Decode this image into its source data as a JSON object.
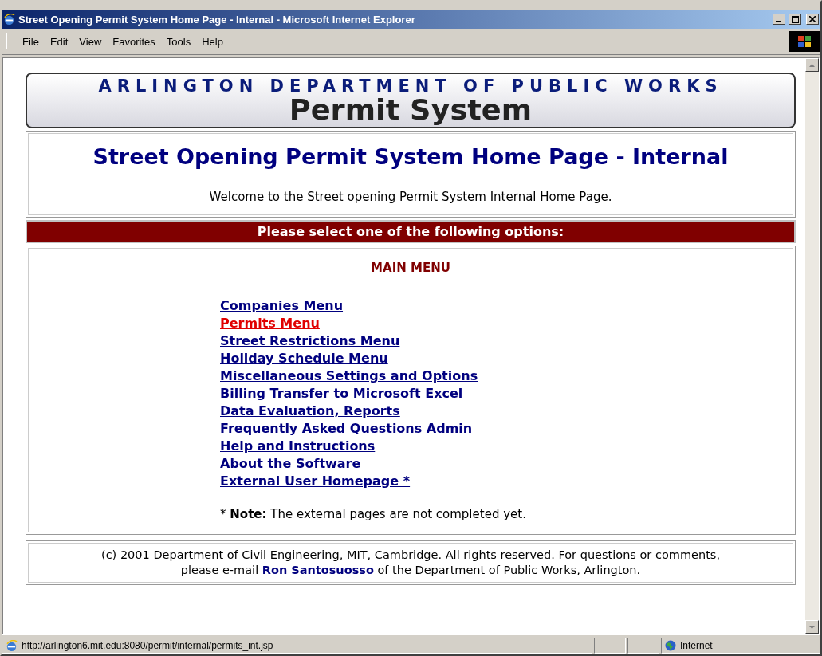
{
  "window": {
    "title": "Street Opening Permit System Home Page - Internal - Microsoft Internet Explorer"
  },
  "menu_bar": [
    "File",
    "Edit",
    "View",
    "Favorites",
    "Tools",
    "Help"
  ],
  "banner": {
    "organization": "ARLINGTON DEPARTMENT OF PUBLIC WORKS",
    "product": "Permit System"
  },
  "header": {
    "title": "Street Opening Permit System Home Page - Internal",
    "welcome": "Welcome to the Street opening Permit System Internal Home Page."
  },
  "options_bar": "Please select one of the following options:",
  "main_menu": {
    "heading": "MAIN MENU",
    "links": [
      {
        "label": "Companies Menu",
        "selected": false
      },
      {
        "label": "Permits Menu",
        "selected": true
      },
      {
        "label": "Street Restrictions Menu",
        "selected": false
      },
      {
        "label": "Holiday Schedule Menu",
        "selected": false
      },
      {
        "label": "Miscellaneous Settings and Options",
        "selected": false
      },
      {
        "label": "Billing Transfer to Microsoft Excel",
        "selected": false
      },
      {
        "label": "Data Evaluation, Reports",
        "selected": false
      },
      {
        "label": "Frequently Asked Questions Admin",
        "selected": false
      },
      {
        "label": "Help and Instructions",
        "selected": false
      },
      {
        "label": "About the Software",
        "selected": false
      },
      {
        "label": "External User Homepage *",
        "selected": false
      }
    ],
    "note": "* **Note:** The external pages are not completed yet."
  },
  "footer": {
    "line_1": "(c) 2001 Department of Civil Engineering, MIT, Cambridge. All rights reserved. For questions or comments,",
    "before_link": "please e-mail",
    "link": "Ron Santosuosso",
    "after_link": "of the Department of Public Works, Arlington."
  },
  "status_bar": {
    "url": "http://arlington6.mit.edu:8080/permit/internal/permits_int.jsp",
    "zone": "Internet"
  }
}
